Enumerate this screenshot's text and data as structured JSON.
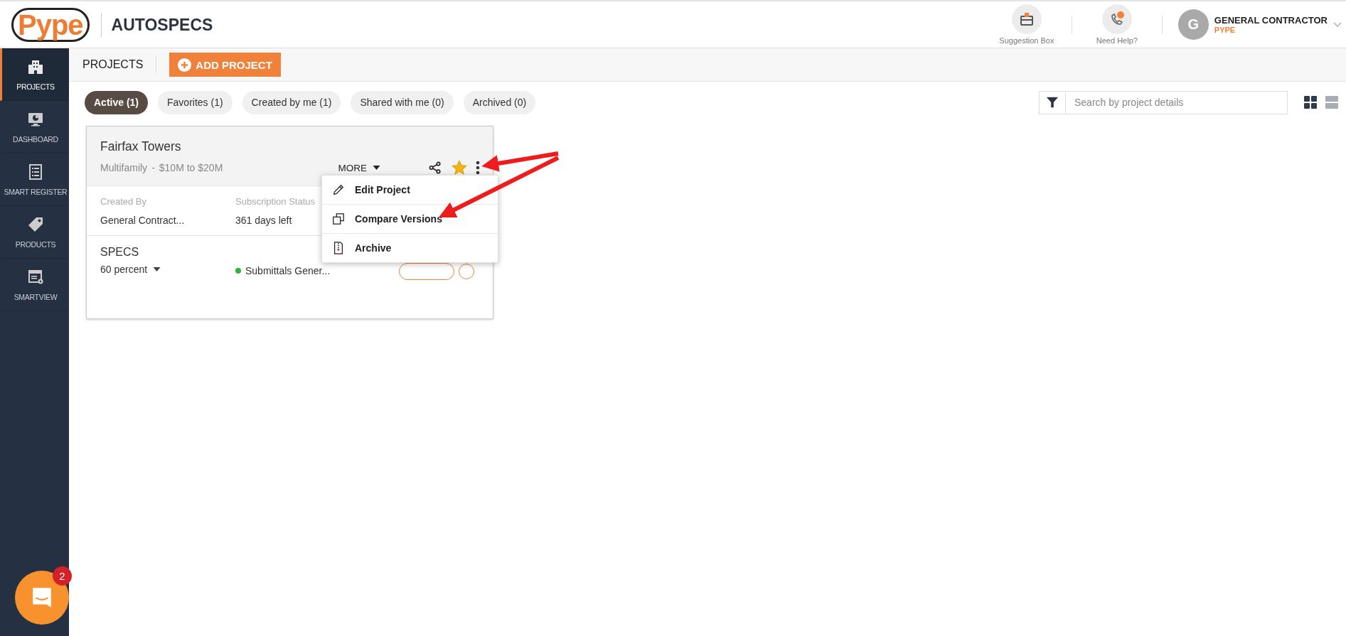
{
  "header": {
    "logo": "Pype",
    "product": "AUTOSPECS",
    "actions": [
      {
        "kind": "suggestion",
        "label": "Suggestion Box"
      },
      {
        "kind": "help",
        "label": "Need Help?"
      }
    ],
    "user": {
      "initial": "G",
      "name": "GENERAL CONTRACTOR",
      "company": "PYPE"
    }
  },
  "sidebar": {
    "items": [
      {
        "kind": "projects",
        "label": "PROJECTS",
        "selected": true
      },
      {
        "kind": "dashboard",
        "label": "DASHBOARD",
        "selected": false
      },
      {
        "kind": "register",
        "label": "SMART REGISTER",
        "selected": false
      },
      {
        "kind": "products",
        "label": "PRODUCTS",
        "selected": false
      },
      {
        "kind": "smartview",
        "label": "SMARTVIEW",
        "selected": false
      }
    ]
  },
  "toolbar": {
    "title": "PROJECTS",
    "add_button": "ADD PROJECT"
  },
  "tabs": [
    {
      "label": "Active (1)",
      "selected": true
    },
    {
      "label": "Favorites (1)",
      "selected": false
    },
    {
      "label": "Created by me (1)",
      "selected": false
    },
    {
      "label": "Shared with me (0)",
      "selected": false
    },
    {
      "label": "Archived (0)",
      "selected": false
    }
  ],
  "search": {
    "placeholder": "Search by project details"
  },
  "view_toggle": [
    {
      "kind": "grid",
      "selected": true
    },
    {
      "kind": "list",
      "selected": false
    }
  ],
  "card": {
    "title": "Fairfax Towers",
    "type": "Multifamily",
    "separator": "-",
    "budget": "$10M to $20M",
    "more": "MORE",
    "favorite": true,
    "fields": [
      {
        "label": "Created By",
        "value": "General Contract..."
      },
      {
        "label": "Subscription Status",
        "value": "361 days left"
      }
    ],
    "specs": {
      "title": "SPECS",
      "version": "60 percent",
      "status": {
        "text": "Submittals Gener...",
        "color": "#2bb53a"
      }
    },
    "menu": [
      {
        "kind": "edit",
        "label": "Edit Project"
      },
      {
        "kind": "compare",
        "label": "Compare Versions"
      },
      {
        "kind": "archive",
        "label": "Archive"
      }
    ]
  },
  "chat": {
    "badge": "2"
  }
}
